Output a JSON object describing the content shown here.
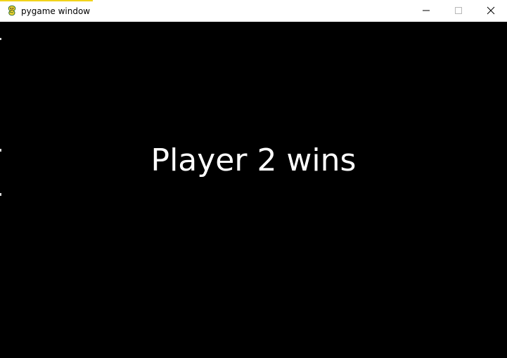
{
  "window": {
    "title": "pygame window",
    "accent_color": "#f2d31b",
    "controls": {
      "minimize_icon": "minimize-icon",
      "maximize_icon": "maximize-icon",
      "close_icon": "close-icon"
    }
  },
  "game": {
    "background_color": "#000000",
    "text_color": "#ffffff",
    "message": "Player 2 wins"
  }
}
